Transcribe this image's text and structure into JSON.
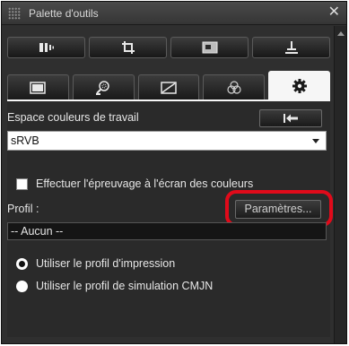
{
  "window": {
    "title": "Palette d'outils",
    "close_icon": "close-icon"
  },
  "tabs": {
    "row1": [
      {
        "icon": "brightness-tool-icon"
      },
      {
        "icon": "crop-tool-icon"
      },
      {
        "icon": "image-view-icon"
      },
      {
        "icon": "stamp-tool-icon"
      }
    ],
    "row2": [
      {
        "icon": "basic-adjust-icon"
      },
      {
        "icon": "magnify-icon"
      },
      {
        "icon": "tone-curve-icon"
      },
      {
        "icon": "color-icon"
      },
      {
        "icon": "settings-icon",
        "active": true
      }
    ]
  },
  "panel": {
    "workspace_label": "Espace couleurs de travail",
    "reset_icon": "reset-arrow-icon",
    "color_space": {
      "selected": "sRVB"
    },
    "soft_proof": {
      "label": "Effectuer l'épreuvage à l'écran des couleurs",
      "checked": false
    },
    "profile_label": "Profil :",
    "settings_button": "Paramètres...",
    "profile_value": "-- Aucun --",
    "options": [
      {
        "label": "Utiliser le profil d'impression",
        "selected": true
      },
      {
        "label": "Utiliser le profil de simulation CMJN",
        "selected": false
      }
    ]
  },
  "colors": {
    "highlight": "#e00a1a",
    "active_tab": "#f6f6f6",
    "panel_bg": "#2a2a2a"
  }
}
